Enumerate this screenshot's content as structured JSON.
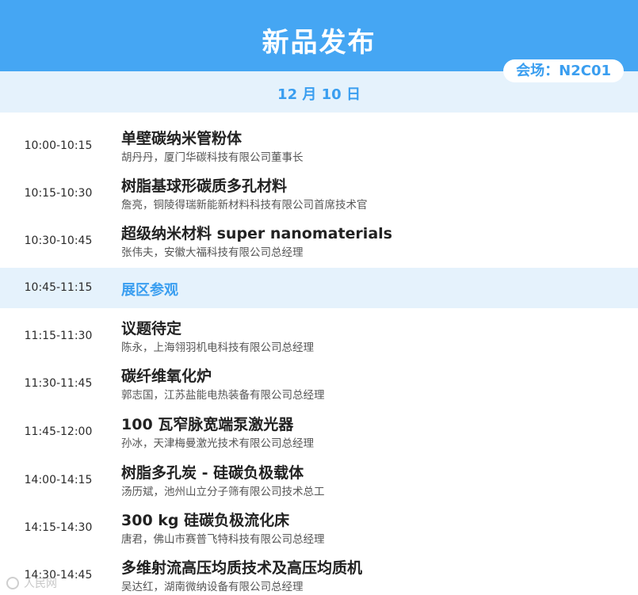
{
  "header": {
    "title": "新品发布",
    "venue": "会场：N2C01"
  },
  "date": "12 月 10 日",
  "sessions_morning": [
    {
      "time": "10:00-10:15",
      "title": "单壁碳纳米管粉体",
      "speaker": "胡丹丹，厦门华碳科技有限公司董事长"
    },
    {
      "time": "10:15-10:30",
      "title": "树脂基球形碳质多孔材料",
      "speaker": "詹亮，铜陵得瑞新能新材料科技有限公司首席技术官"
    },
    {
      "time": "10:30-10:45",
      "title": "超级纳米材料 super nanomaterials",
      "speaker": "张伟夫，安徽大福科技有限公司总经理"
    }
  ],
  "break": {
    "time": "10:45-11:15",
    "title": "展区参观"
  },
  "sessions_later": [
    {
      "time": "11:15-11:30",
      "title": "议题待定",
      "speaker": "陈永，上海翎羽机电科技有限公司总经理"
    },
    {
      "time": "11:30-11:45",
      "title": "碳纤维氧化炉",
      "speaker": "郭志国，江苏盐能电热装备有限公司总经理"
    },
    {
      "time": "11:45-12:00",
      "title": "100 瓦窄脉宽端泵激光器",
      "speaker": "孙冰，天津梅曼激光技术有限公司总经理"
    },
    {
      "time": "14:00-14:15",
      "title": "树脂多孔炭 - 硅碳负极载体",
      "speaker": "汤历斌，池州山立分子筛有限公司技术总工"
    },
    {
      "time": "14:15-14:30",
      "title": "300 kg 硅碳负极流化床",
      "speaker": "唐君，佛山市赛普飞特科技有限公司总经理"
    },
    {
      "time": "14:30-14:45",
      "title": "多维射流高压均质技术及高压均质机",
      "speaker": "吴达红，湖南微纳设备有限公司总经理"
    }
  ],
  "watermark": {
    "text": "人民网"
  },
  "colors": {
    "header_blue": "#45a6f3",
    "band_light": "#e5f2fc",
    "accent_text": "#3a9ef0"
  }
}
